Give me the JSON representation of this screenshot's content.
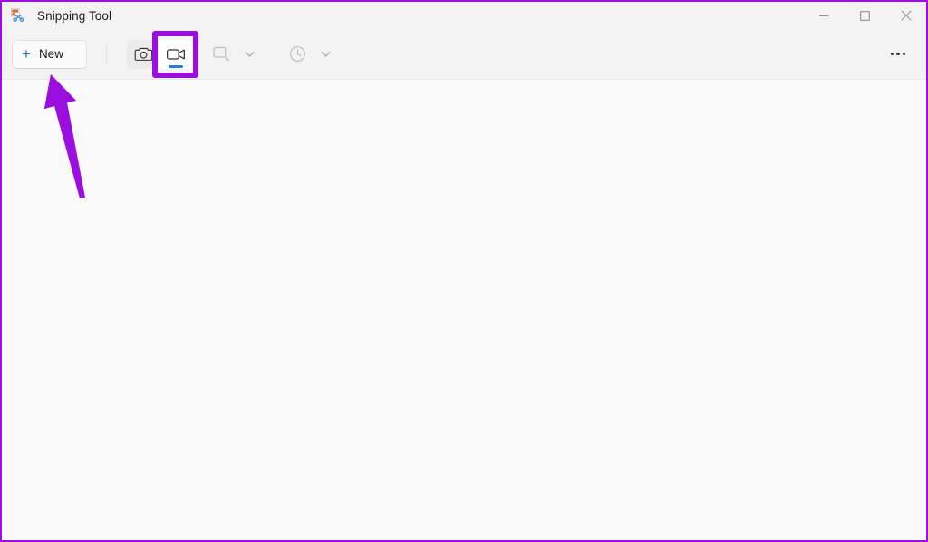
{
  "window": {
    "title": "Snipping Tool",
    "app_icon": "snipping-tool-icon",
    "controls": {
      "minimize_label": "Minimize",
      "maximize_label": "Maximize",
      "close_label": "Close"
    }
  },
  "toolbar": {
    "new_button": {
      "label": "New",
      "icon": "plus-icon"
    },
    "capture_mode": {
      "screenshot": {
        "icon": "camera-icon",
        "label": "Screenshot mode",
        "state": "hovered"
      },
      "record": {
        "icon": "video-camera-icon",
        "label": "Record mode",
        "state": "selected"
      }
    },
    "snip_mode": {
      "icon": "rectangle-snip-icon",
      "label": "Snipping mode",
      "chevron": "chevron-down-icon",
      "state": "disabled"
    },
    "delay": {
      "icon": "clock-icon",
      "label": "Delay",
      "chevron": "chevron-down-icon",
      "state": "disabled"
    },
    "more": {
      "icon": "ellipsis-icon",
      "label": "See more"
    }
  },
  "annotations": {
    "highlight_box": {
      "name": "record-button-highlight",
      "color": "#9A0FDE"
    },
    "arrow": {
      "name": "pointer-arrow",
      "color": "#9A0FDE",
      "points_to": "New"
    },
    "window_outline": {
      "color": "#9A0FDE"
    }
  },
  "colors": {
    "accent_blue": "#2D7CD6",
    "plus_blue": "#1a6fc4",
    "annotation_purple": "#9A0FDE",
    "titlebar_bg": "#F3F3F3",
    "content_bg": "#FAFAFA"
  },
  "content": {
    "body_text": ""
  }
}
